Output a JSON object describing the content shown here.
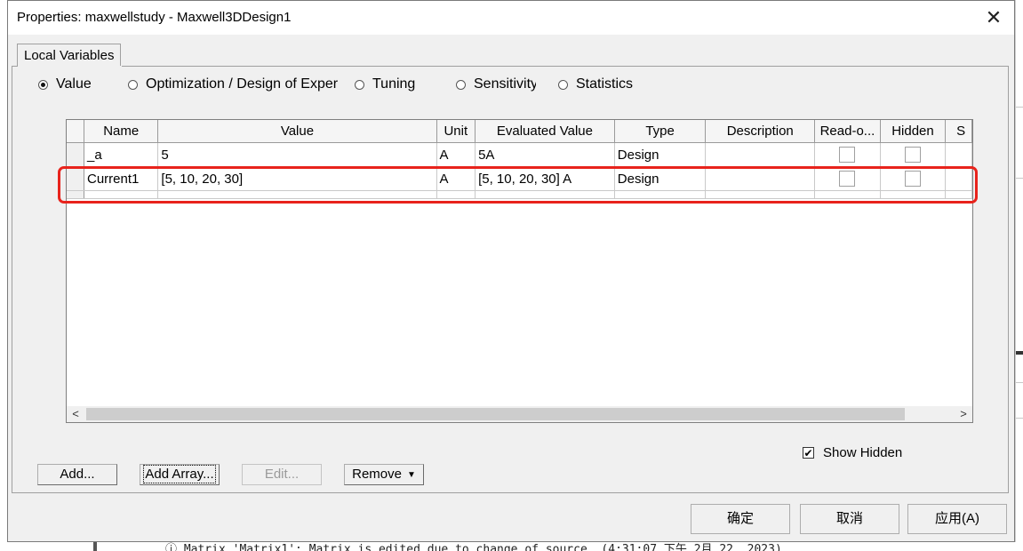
{
  "window": {
    "title": "Properties: maxwellstudy - Maxwell3DDesign1",
    "close_glyph": "✕"
  },
  "tabs": [
    {
      "label": "Local Variables"
    }
  ],
  "radio_options": [
    {
      "label": "Value",
      "selected": true
    },
    {
      "label": "Optimization / Design of Exper",
      "selected": false
    },
    {
      "label": "Tuning",
      "selected": false
    },
    {
      "label": "Sensitivity",
      "selected": false
    },
    {
      "label": "Statistics",
      "selected": false
    }
  ],
  "table": {
    "columns": [
      "Name",
      "Value",
      "Unit",
      "Evaluated Value",
      "Type",
      "Description",
      "Read-o...",
      "Hidden",
      "S"
    ],
    "rows": [
      {
        "name": "_a",
        "value": "5",
        "unit": "A",
        "evaluated": "5A",
        "type": "Design",
        "description": "",
        "readonly": false,
        "hidden": false
      },
      {
        "name": "Current1",
        "value": "[5, 10, 20, 30]",
        "unit": "A",
        "evaluated": "[5, 10, 20, 30] A",
        "type": "Design",
        "description": "",
        "readonly": false,
        "hidden": false
      }
    ]
  },
  "scrollbar": {
    "left_glyph": "<",
    "right_glyph": ">"
  },
  "show_hidden": {
    "label": "Show Hidden",
    "checked": true,
    "check_glyph": "✔"
  },
  "buttons": {
    "add": "Add...",
    "add_array": "Add Array...",
    "edit": "Edit...",
    "remove": "Remove",
    "ok": "确定",
    "cancel": "取消",
    "apply": "应用(A)"
  },
  "background_log": {
    "text": "ⓘ Matrix 'Matrix1': Matrix is edited due to change of source. (4:31:07 下午  2月 22, 2023)"
  },
  "colors": {
    "highlight": "#e8231c",
    "dialog_bg": "#f0f0f0"
  }
}
